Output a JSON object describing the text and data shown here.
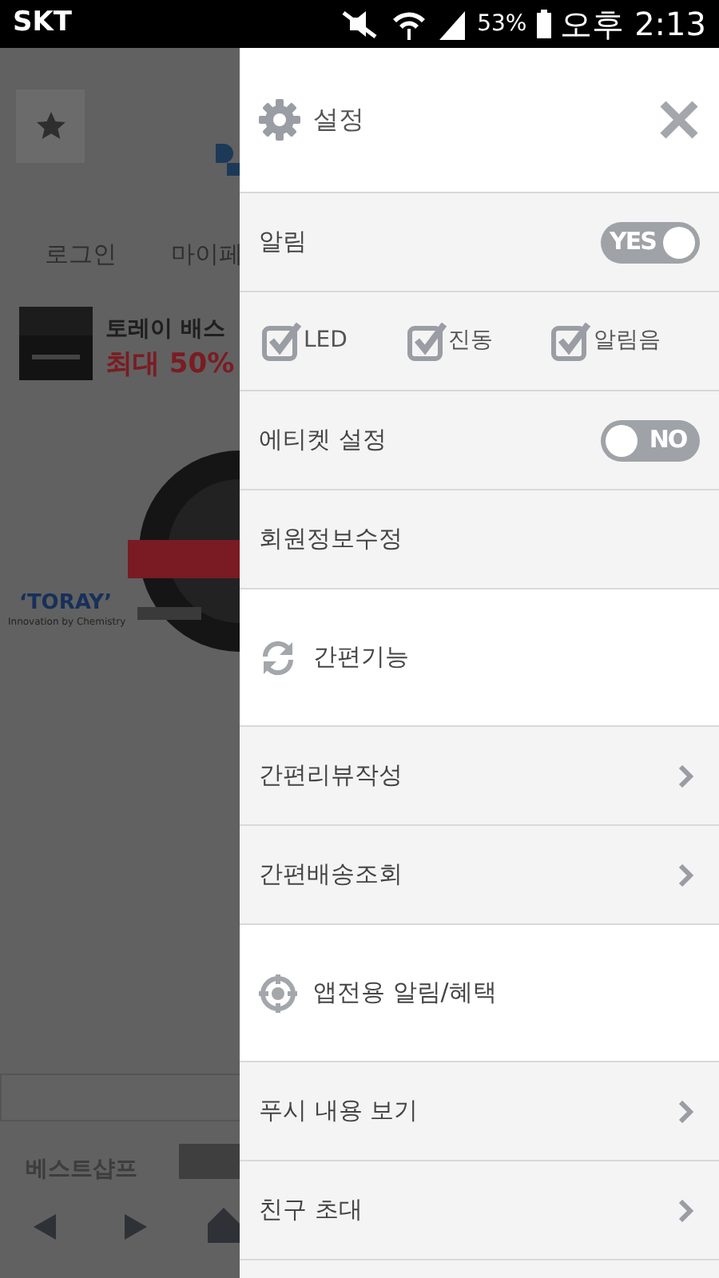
{
  "status_bar": {
    "carrier": "SKT",
    "battery": "53%",
    "time": "오후 2:13"
  },
  "background_page": {
    "tabs": [
      "로그인",
      "마이페"
    ],
    "banner": {
      "title": "토레이 배스",
      "subtitle": "최대 50%"
    },
    "brand": {
      "name": "‘TORAY’",
      "tagline": "Innovation by Chemistry"
    },
    "bottom_tab": "베스트샵프"
  },
  "drawer": {
    "title": "설정",
    "rows": [
      {
        "kind": "toggle",
        "label": "알림",
        "on": true,
        "text": "YES"
      },
      {
        "kind": "checks",
        "items": [
          {
            "label": "LED",
            "checked": true
          },
          {
            "label": "진동",
            "checked": true
          },
          {
            "label": "알림음",
            "checked": true
          }
        ]
      },
      {
        "kind": "toggle",
        "label": "에티켓 설정",
        "on": false,
        "text": "NO"
      },
      {
        "kind": "plain",
        "label": "회원정보수정"
      },
      {
        "kind": "section",
        "label": "간편기능"
      },
      {
        "kind": "link",
        "label": "간편리뷰작성"
      },
      {
        "kind": "link",
        "label": "간편배송조회"
      },
      {
        "kind": "section",
        "label": "앱전용 알림/혜택"
      },
      {
        "kind": "link",
        "label": "푸시 내용 보기"
      },
      {
        "kind": "link",
        "label": "친구 초대"
      }
    ]
  }
}
